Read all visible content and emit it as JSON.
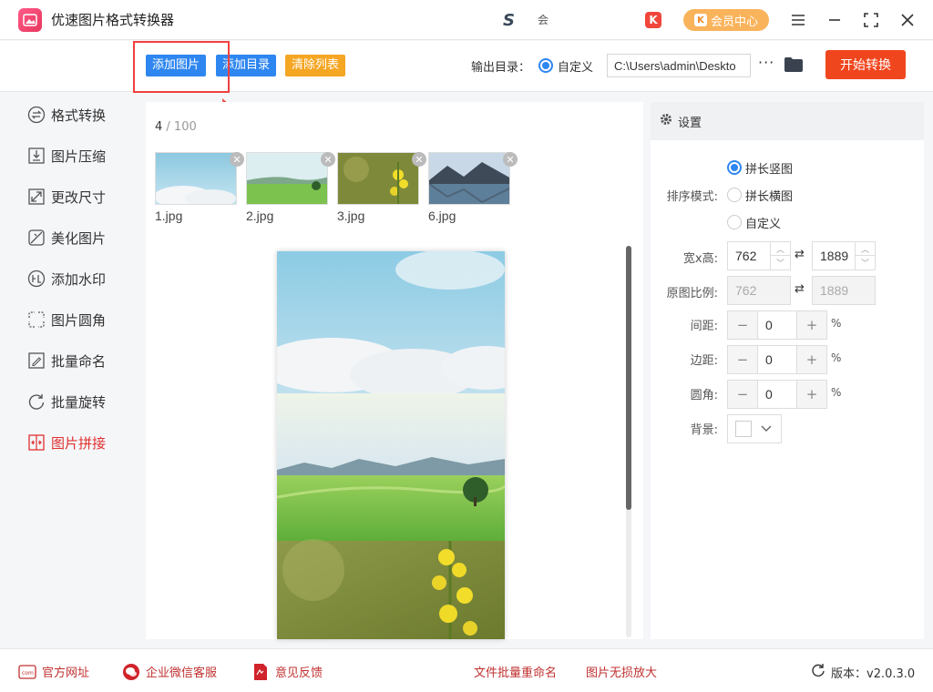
{
  "app": {
    "title": "优速图片格式转换器",
    "s_text": "会",
    "vip_label": "会员中心"
  },
  "toolbar": {
    "add_image": "添加图片",
    "add_folder": "添加目录",
    "clear_list": "清除列表",
    "output_label": "输出目录：",
    "output_mode": "自定义",
    "output_path": "C:\\Users\\admin\\Deskto",
    "more": "···",
    "start": "开始转换"
  },
  "sidebar": {
    "items": [
      {
        "label": "格式转换",
        "icon": "format-convert-icon"
      },
      {
        "label": "图片压缩",
        "icon": "compress-icon"
      },
      {
        "label": "更改尺寸",
        "icon": "resize-icon"
      },
      {
        "label": "美化图片",
        "icon": "beautify-icon"
      },
      {
        "label": "添加水印",
        "icon": "watermark-icon"
      },
      {
        "label": "图片圆角",
        "icon": "round-corner-icon"
      },
      {
        "label": "批量命名",
        "icon": "rename-icon"
      },
      {
        "label": "批量旋转",
        "icon": "rotate-icon"
      },
      {
        "label": "图片拼接",
        "icon": "stitch-icon",
        "active": true
      }
    ]
  },
  "files": {
    "count": "4",
    "total": "/ 100",
    "items": [
      {
        "name": "1.jpg"
      },
      {
        "name": "2.jpg"
      },
      {
        "name": "3.jpg"
      },
      {
        "name": "6.jpg"
      }
    ]
  },
  "settings": {
    "title": "设置",
    "sort_label": "排序模式:",
    "sort_options": [
      "拼长竖图",
      "拼长横图",
      "自定义"
    ],
    "sort_selected": 0,
    "wh_label": "宽x高:",
    "width": "762",
    "height": "1889",
    "ratio_label": "原图比例:",
    "ratio_width": "762",
    "ratio_height": "1889",
    "spacing_label": "间距:",
    "spacing": "0",
    "margin_label": "边距:",
    "margin": "0",
    "radius_label": "圆角:",
    "radius": "0",
    "percent": "%",
    "bg_label": "背景:"
  },
  "footer": {
    "website": "官方网址",
    "wechat": "企业微信客服",
    "feedback": "意见反馈",
    "batch_rename": "文件批量重命名",
    "upscale": "图片无损放大",
    "version": "版本：v2.0.3.0"
  },
  "colors": {
    "accent": "#2e86f0",
    "start": "#f0461e",
    "danger": "#e03030",
    "orange": "#f5a623"
  }
}
